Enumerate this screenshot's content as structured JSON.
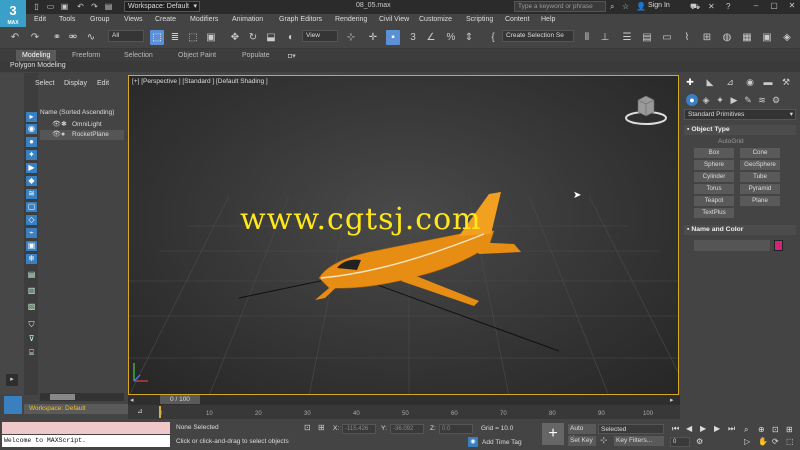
{
  "app": {
    "logo_text": "3",
    "logo_sub": "MAX",
    "file_title": "08_05.max",
    "workspace_label": "Workspace: Default",
    "search_placeholder": "Type a keyword or phrase",
    "signin_label": "Sign In"
  },
  "menu": [
    "Edit",
    "Tools",
    "Group",
    "Views",
    "Create",
    "Modifiers",
    "Animation",
    "Graph Editors",
    "Rendering",
    "Civil View",
    "Customize",
    "Scripting",
    "Content",
    "Help"
  ],
  "toolbar": {
    "selection_filter": "All",
    "ref_coord": "View",
    "named_sel": "Create Selection Se"
  },
  "ribbon": {
    "tabs": [
      "Modeling",
      "Freeform",
      "Selection",
      "Object Paint",
      "Populate"
    ],
    "active_tab": "Modeling",
    "sub_label": "Polygon Modeling"
  },
  "explorer": {
    "tabs": [
      "Select",
      "Display",
      "Edit"
    ],
    "header": "Name (Sorted Ascending)",
    "rows": [
      "OmniLight",
      "RocketPlane"
    ]
  },
  "viewport": {
    "label": "[+] [Perspective ] [Standard ] [Default Shading ]",
    "watermark": "www.cgtsj.com"
  },
  "command_panel": {
    "category": "Standard Primitives",
    "object_type_title": "Object Type",
    "autogrid": "AutoGrid",
    "buttons": [
      "Box",
      "Cone",
      "Sphere",
      "GeoSphere",
      "Cylinder",
      "Tube",
      "Torus",
      "Pyramid",
      "Teapot",
      "Plane",
      "TextPlus"
    ],
    "name_color_title": "Name and Color",
    "swatch_color": "#d4247a"
  },
  "timeline": {
    "slider": "0 / 100",
    "ticks": [
      "0",
      "10",
      "20",
      "30",
      "40",
      "50",
      "60",
      "70",
      "80",
      "90",
      "100"
    ]
  },
  "status": {
    "workspace": "Workspace: Default",
    "listener": "Welcome to MAXScript.",
    "selection": "None Selected",
    "prompt": "Click or click-and-drag to select objects",
    "x_label": "X:",
    "x_value": "-115.426",
    "y_label": "Y:",
    "y_value": "-36.092",
    "z_label": "Z:",
    "z_value": "0.0",
    "grid": "Grid = 10.0",
    "add_time_tag": "Add Time Tag",
    "auto_key": "Auto Key",
    "set_key": "Set Key",
    "selected_dd": "Selected",
    "key_filters": "Key Filters...",
    "frame": "0"
  }
}
